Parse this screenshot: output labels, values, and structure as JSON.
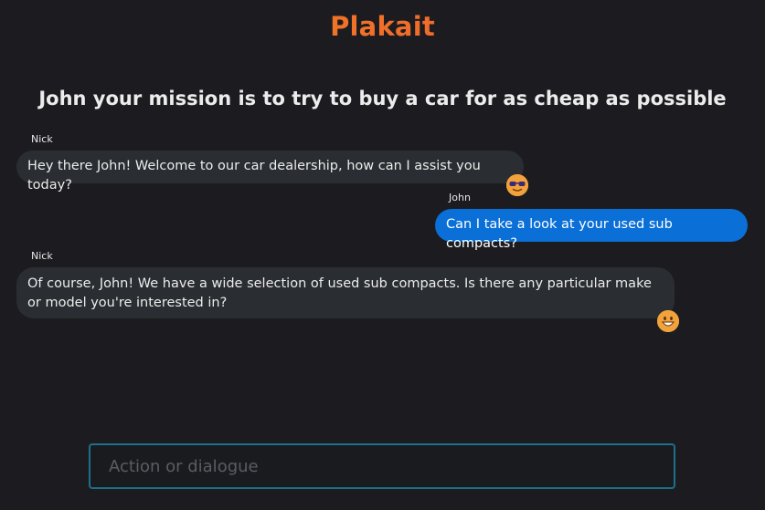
{
  "app": {
    "title": "Plakait",
    "mission": "John your mission is to try to buy a car for as cheap as possible"
  },
  "messages": [
    {
      "sender": "Nick",
      "text": "Hey there John! Welcome to our car dealership, how can I assist you today?",
      "role": "bot",
      "reaction": "sunglasses-face-icon"
    },
    {
      "sender": "John",
      "text": "Can I take a look at your used sub compacts?",
      "role": "user"
    },
    {
      "sender": "Nick",
      "text": "Of course, John! We have a wide selection of used sub compacts. Is there any particular make or model you're interested in?",
      "role": "bot",
      "reaction": "grinning-face-icon"
    }
  ],
  "composer": {
    "placeholder": "Action or dialogue",
    "value": ""
  },
  "colors": {
    "background": "#1c1c20",
    "bot_bubble": "#2a2d31",
    "user_bubble": "#0a6fd6",
    "brand_start": "#f28a1e",
    "brand_end": "#e8524a",
    "input_border": "#1d6f8c"
  }
}
